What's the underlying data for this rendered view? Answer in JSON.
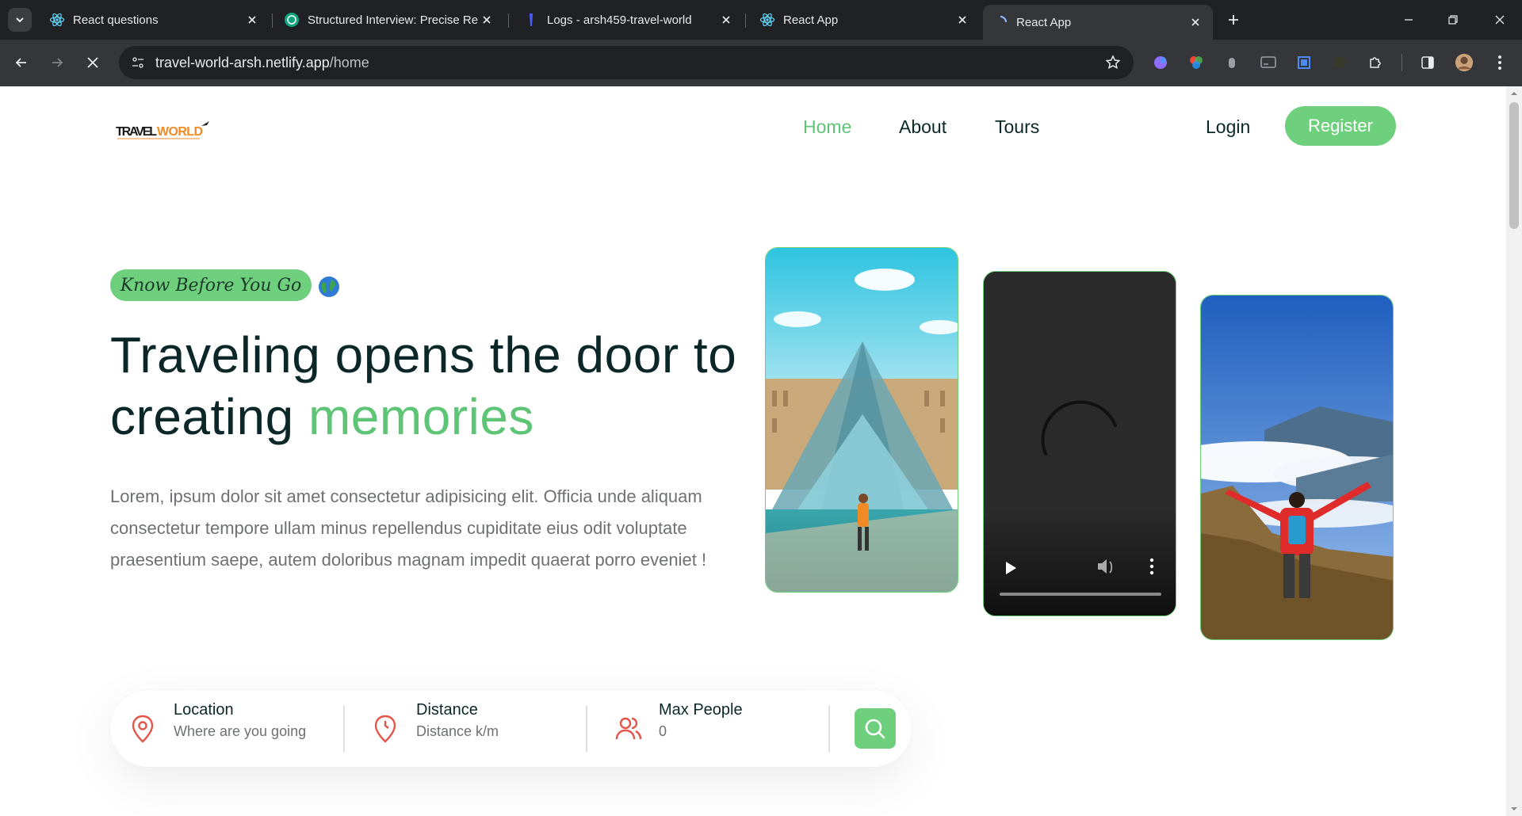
{
  "browser": {
    "tabs": [
      {
        "title": "React questions",
        "icon": "react-icon"
      },
      {
        "title": "Structured Interview: Precise Re",
        "icon": "chatgpt-icon"
      },
      {
        "title": "Logs - arsh459-travel-world",
        "icon": "render-icon"
      },
      {
        "title": "React App",
        "icon": "react-icon"
      },
      {
        "title": "React App",
        "icon": "loading-icon",
        "active": true
      }
    ],
    "url_host": "travel-world-arsh.netlify.app",
    "url_path": "/home"
  },
  "header": {
    "logo_text": "TRAVELWORLD",
    "nav": [
      {
        "label": "Home",
        "active": true
      },
      {
        "label": "About",
        "active": false
      },
      {
        "label": "Tours",
        "active": false
      }
    ],
    "login_label": "Login",
    "register_label": "Register"
  },
  "hero": {
    "tag": "Know Before You Go",
    "headline_part1": "Traveling opens the door to creating ",
    "headline_highlight": "memories",
    "description": "Lorem, ipsum dolor sit amet consectetur adipisicing elit. Officia unde aliquam consectetur tempore ullam minus repellendus cupiditate eius odit voluptate praesentium saepe, autem doloribus magnam impedit quaerat porro eveniet !"
  },
  "search": {
    "location_label": "Location",
    "location_placeholder": "Where are you going",
    "distance_label": "Distance",
    "distance_placeholder": "Distance k/m",
    "people_label": "Max People",
    "people_placeholder": "0"
  },
  "colors": {
    "accent": "#5ec576",
    "heading": "#0b2727",
    "icon_red": "#e4564a"
  }
}
